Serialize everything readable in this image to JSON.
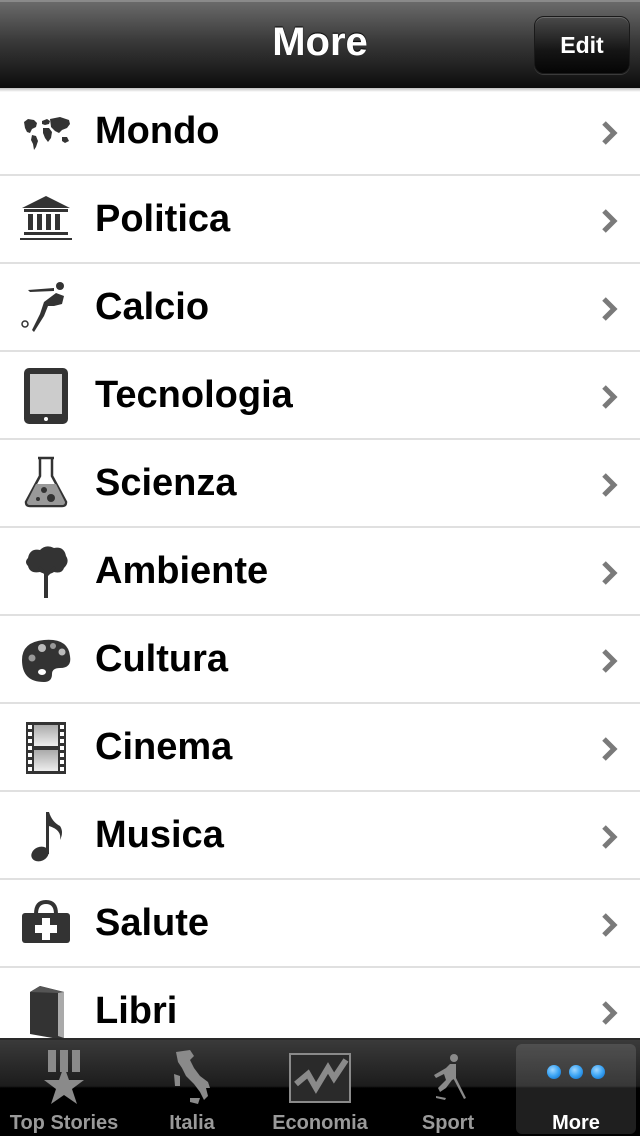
{
  "navbar": {
    "title": "More",
    "edit_label": "Edit"
  },
  "list": {
    "items": [
      {
        "label": "Mondo",
        "icon": "world-map-icon"
      },
      {
        "label": "Politica",
        "icon": "government-building-icon"
      },
      {
        "label": "Calcio",
        "icon": "soccer-player-icon"
      },
      {
        "label": "Tecnologia",
        "icon": "tablet-icon"
      },
      {
        "label": "Scienza",
        "icon": "flask-icon"
      },
      {
        "label": "Ambiente",
        "icon": "tree-icon"
      },
      {
        "label": "Cultura",
        "icon": "palette-icon"
      },
      {
        "label": "Cinema",
        "icon": "film-strip-icon"
      },
      {
        "label": "Musica",
        "icon": "music-note-icon"
      },
      {
        "label": "Salute",
        "icon": "medical-kit-icon"
      },
      {
        "label": "Libri",
        "icon": "book-icon"
      }
    ]
  },
  "tabbar": {
    "tabs": [
      {
        "label": "Top Stories",
        "icon": "medal-star-icon",
        "selected": false
      },
      {
        "label": "Italia",
        "icon": "italy-map-icon",
        "selected": false
      },
      {
        "label": "Economia",
        "icon": "stock-chart-icon",
        "selected": false
      },
      {
        "label": "Sport",
        "icon": "hockey-player-icon",
        "selected": false
      },
      {
        "label": "More",
        "icon": "more-dots-icon",
        "selected": true
      }
    ]
  },
  "colors": {
    "accent_blue": "#3ea6f5",
    "icon_gray": "#333333",
    "chevron": "#7a7a7a"
  }
}
